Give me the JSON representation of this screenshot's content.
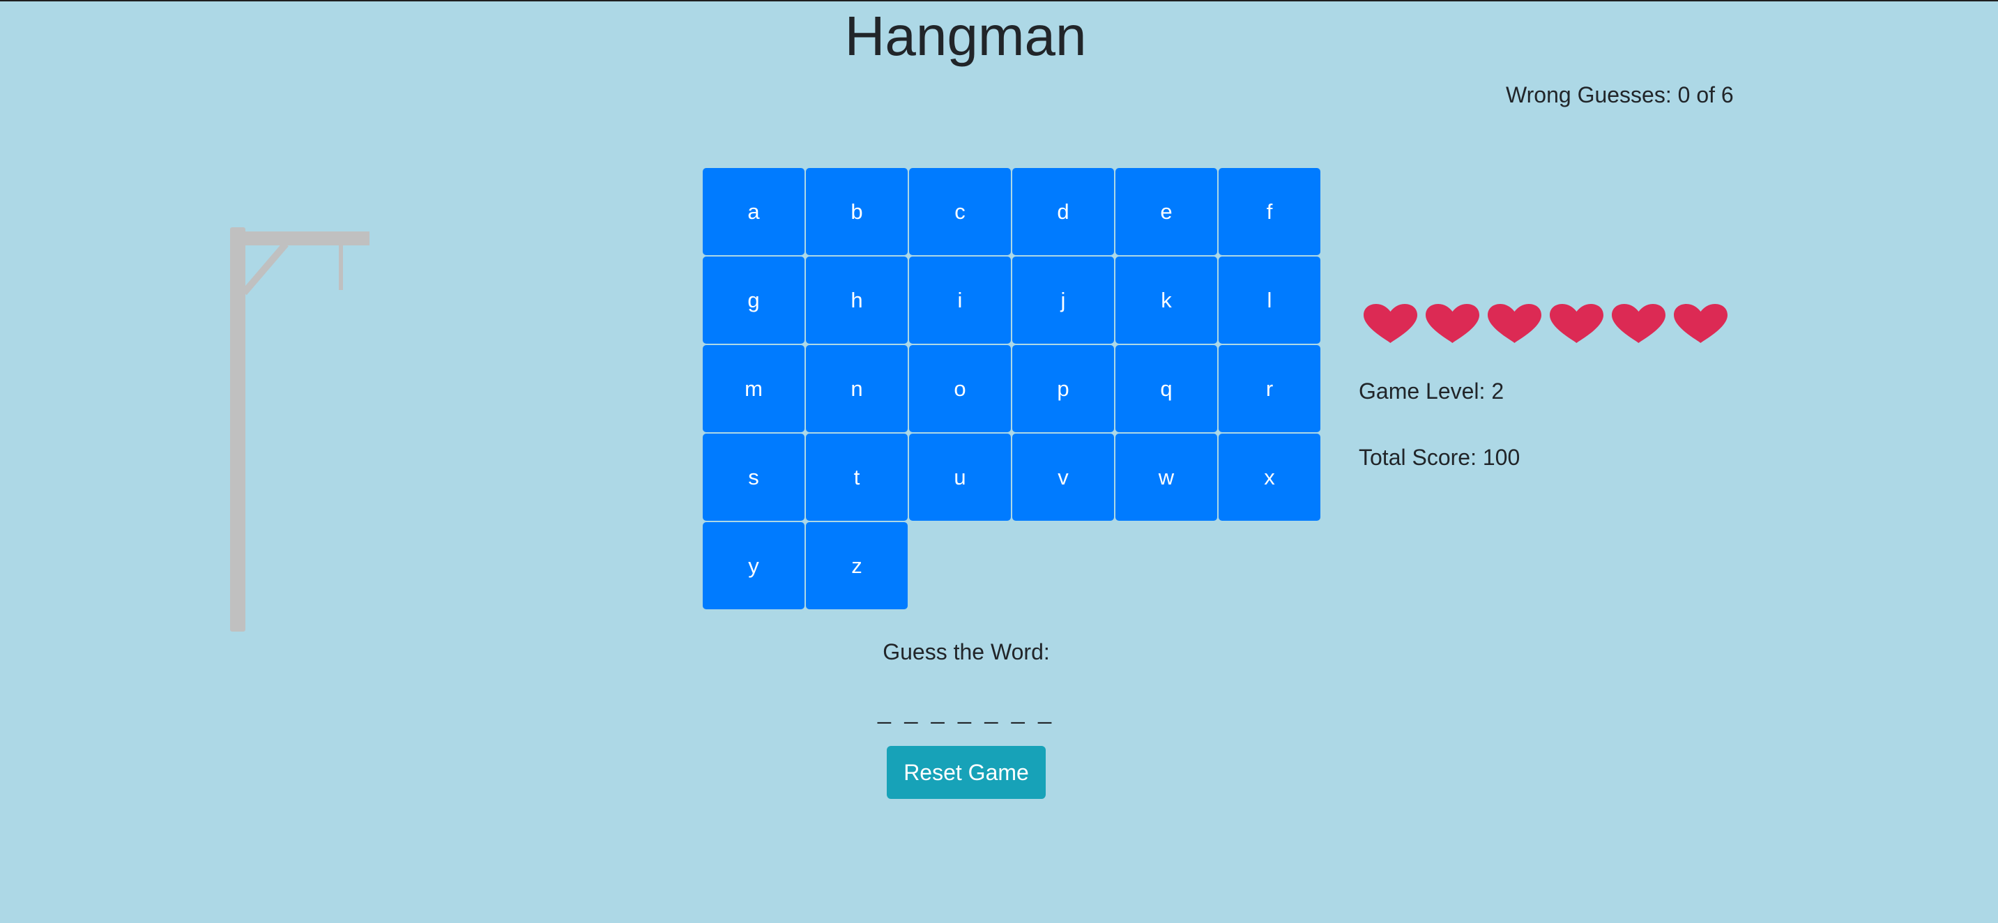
{
  "header": {
    "title": "Hangman"
  },
  "status": {
    "wrong_guesses": "Wrong Guesses: 0 of 6",
    "game_level": "Game Level: 2",
    "total_score": "Total Score: 100",
    "lives_remaining": 6,
    "heart_color": "#dc2a54"
  },
  "keyboard": {
    "letters": [
      "a",
      "b",
      "c",
      "d",
      "e",
      "f",
      "g",
      "h",
      "i",
      "j",
      "k",
      "l",
      "m",
      "n",
      "o",
      "p",
      "q",
      "r",
      "s",
      "t",
      "u",
      "v",
      "w",
      "x",
      "y",
      "z"
    ],
    "button_color": "#007bff"
  },
  "word": {
    "prompt": "Guess the Word:",
    "blanks": "_ _ _ _ _ _ _"
  },
  "controls": {
    "reset_label": "Reset Game",
    "reset_color": "#17a2b8"
  },
  "theme": {
    "background": "#add8e6",
    "gallows_color": "#c0c0c0"
  }
}
